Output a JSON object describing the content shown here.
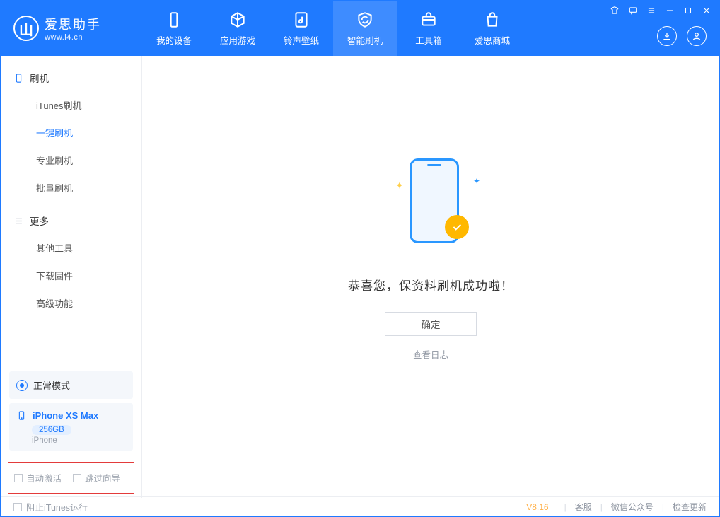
{
  "brand": {
    "name": "爱思助手",
    "url": "www.i4.cn"
  },
  "tabs": [
    {
      "label": "我的设备"
    },
    {
      "label": "应用游戏"
    },
    {
      "label": "铃声壁纸"
    },
    {
      "label": "智能刷机"
    },
    {
      "label": "工具箱"
    },
    {
      "label": "爱思商城"
    }
  ],
  "sidebar": {
    "group1_title": "刷机",
    "items1": [
      {
        "label": "iTunes刷机"
      },
      {
        "label": "一键刷机"
      },
      {
        "label": "专业刷机"
      },
      {
        "label": "批量刷机"
      }
    ],
    "group2_title": "更多",
    "items2": [
      {
        "label": "其他工具"
      },
      {
        "label": "下载固件"
      },
      {
        "label": "高级功能"
      }
    ]
  },
  "device": {
    "mode": "正常模式",
    "name": "iPhone XS Max",
    "capacity": "256GB",
    "subtype": "iPhone"
  },
  "options": {
    "auto_activate": "自动激活",
    "skip_wizard": "跳过向导"
  },
  "main": {
    "success_text": "恭喜您，保资料刷机成功啦！",
    "ok_button": "确定",
    "log_link": "查看日志"
  },
  "footer": {
    "block_itunes": "阻止iTunes运行",
    "version": "V8.16",
    "support": "客服",
    "wechat": "微信公众号",
    "update": "检查更新"
  }
}
